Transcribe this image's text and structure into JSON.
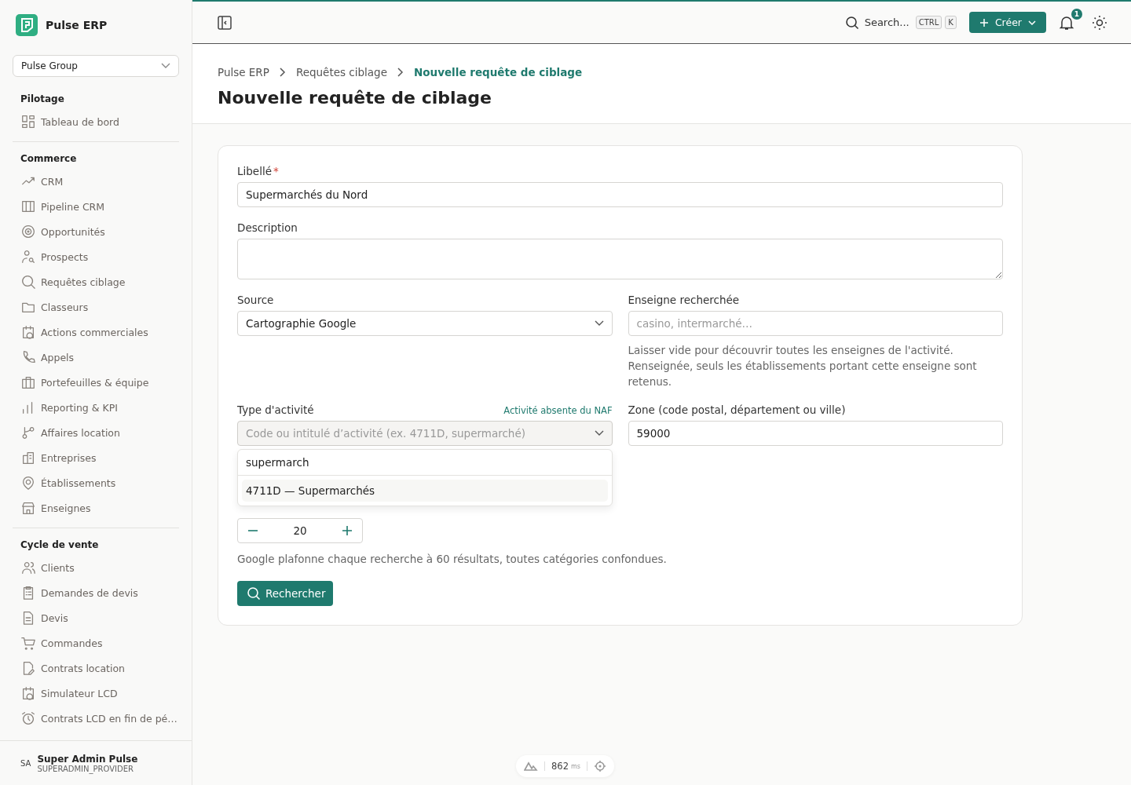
{
  "app": {
    "name": "Pulse ERP"
  },
  "org_select": {
    "value": "Pulse Group"
  },
  "sidebar": {
    "sections": [
      {
        "title": "Pilotage",
        "items": [
          {
            "label": "Tableau de bord",
            "selected": false
          }
        ]
      },
      {
        "title": "Commerce",
        "items": [
          {
            "label": "CRM",
            "selected": false
          },
          {
            "label": "Pipeline CRM",
            "selected": false
          },
          {
            "label": "Opportunités",
            "selected": false
          },
          {
            "label": "Prospects",
            "selected": false
          },
          {
            "label": "Requêtes ciblage",
            "selected": false
          },
          {
            "label": "Classeurs",
            "selected": false
          },
          {
            "label": "Actions commerciales",
            "selected": false
          },
          {
            "label": "Appels",
            "selected": false
          },
          {
            "label": "Portefeuilles & équipe",
            "selected": false
          },
          {
            "label": "Reporting & KPI",
            "selected": false
          },
          {
            "label": "Affaires location",
            "selected": false
          },
          {
            "label": "Entreprises",
            "selected": false
          },
          {
            "label": "Établissements",
            "selected": false
          },
          {
            "label": "Enseignes",
            "selected": false
          }
        ]
      },
      {
        "title": "Cycle de vente",
        "items": [
          {
            "label": "Clients",
            "selected": false
          },
          {
            "label": "Demandes de devis",
            "selected": false
          },
          {
            "label": "Devis",
            "selected": false
          },
          {
            "label": "Commandes",
            "selected": false
          },
          {
            "label": "Contrats location",
            "selected": false
          },
          {
            "label": "Simulateur LCD",
            "selected": false
          },
          {
            "label": "Contrats LCD en fin de pé…",
            "selected": false
          }
        ]
      }
    ]
  },
  "user": {
    "initials": "SA",
    "name": "Super Admin Pulse",
    "role": "SUPERADMIN_PROVIDER"
  },
  "topbar": {
    "search": "Search...",
    "keys": [
      "CTRL",
      "K"
    ],
    "create": "Créer",
    "notifications": "1"
  },
  "breadcrumb": [
    {
      "label": "Pulse ERP",
      "current": false
    },
    {
      "label": "Requêtes ciblage",
      "current": false
    },
    {
      "label": "Nouvelle requête de ciblage",
      "current": true
    }
  ],
  "page_title": "Nouvelle requête de ciblage",
  "form": {
    "label_field": {
      "label": "Libellé",
      "required_mark": "*",
      "value": "Supermarchés du Nord"
    },
    "description": {
      "label": "Description"
    },
    "source": {
      "label": "Source",
      "value": "Cartographie Google"
    },
    "brand": {
      "label": "Enseigne recherchée",
      "placeholder": "casino, intermarché…",
      "help": "Laisser vide pour découvrir toutes les enseignes de l'activité. Renseignée, seuls les établissements portant cette enseigne sont retenus."
    },
    "activity": {
      "label": "Type d'activité",
      "link": "Activité absente du NAF",
      "placeholder": "Code ou intitulé d’activité (ex. 4711D, supermarché)",
      "open": true,
      "query": "supermarch",
      "options": [
        "4711D — Supermarchés"
      ]
    },
    "zone": {
      "label": "Zone (code postal, département ou ville)",
      "value": "59000"
    },
    "max_results": {
      "value": "20",
      "help": "Google plafonne chaque recherche à 60 résultats, toutes catégories confondues."
    },
    "submit": "Rechercher"
  },
  "perf": {
    "value": "862",
    "unit": "ms"
  }
}
